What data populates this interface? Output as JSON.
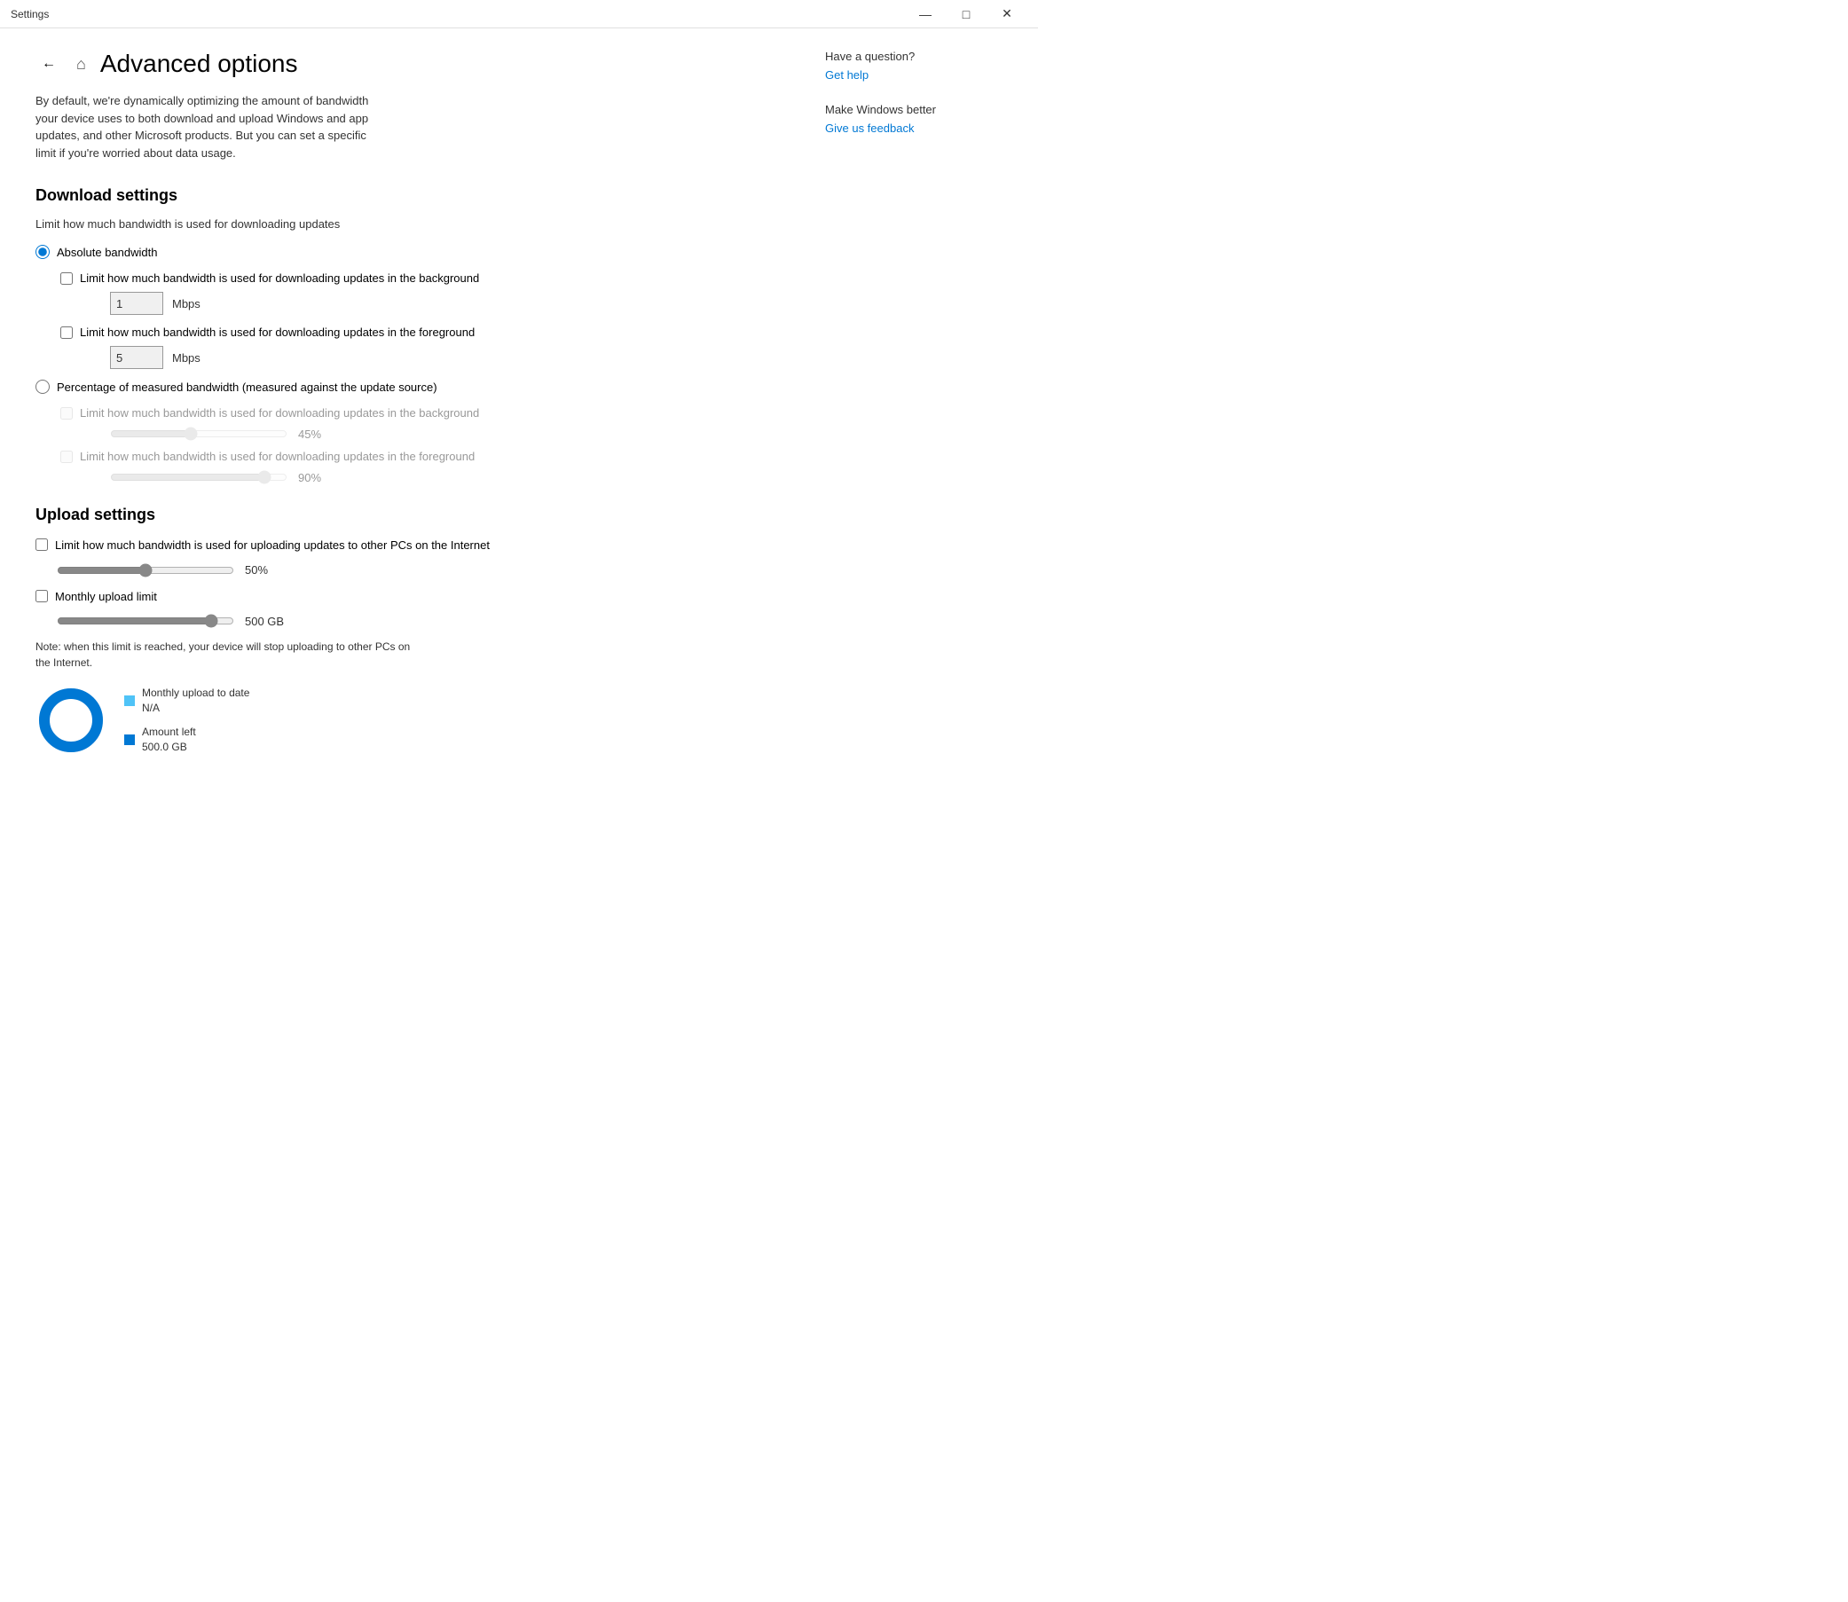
{
  "titlebar": {
    "title": "Settings",
    "minimize": "—",
    "maximize": "□",
    "close": "✕"
  },
  "header": {
    "back_icon": "←",
    "home_icon": "⌂",
    "page_title": "Advanced options"
  },
  "description": "By default, we're dynamically optimizing the amount of bandwidth your device uses to both download and upload Windows and app updates, and other Microsoft products. But you can set a specific limit if you're worried about data usage.",
  "download_settings": {
    "section_title": "Download settings",
    "section_desc": "Limit how much bandwidth is used for downloading updates",
    "radio_absolute": "Absolute bandwidth",
    "radio_absolute_checked": true,
    "radio_percentage": "Percentage of measured bandwidth (measured against the update source)",
    "radio_percentage_checked": false,
    "bg_checkbox_label": "Limit how much bandwidth is used for downloading updates in the background",
    "bg_checkbox_checked": false,
    "bg_input_value": "1",
    "bg_mbps": "Mbps",
    "fg_checkbox_label": "Limit how much bandwidth is used for downloading updates in the foreground",
    "fg_checkbox_checked": false,
    "fg_input_value": "5",
    "fg_mbps": "Mbps",
    "pct_bg_checkbox_label": "Limit how much bandwidth is used for downloading updates in the background",
    "pct_bg_slider_value": "45%",
    "pct_bg_slider": 45,
    "pct_fg_checkbox_label": "Limit how much bandwidth is used for downloading updates in the foreground",
    "pct_fg_slider_value": "90%",
    "pct_fg_slider": 90
  },
  "upload_settings": {
    "section_title": "Upload settings",
    "upload_checkbox_label": "Limit how much bandwidth is used for uploading updates to other PCs on the Internet",
    "upload_checkbox_checked": false,
    "upload_slider_value": "50%",
    "upload_slider": 50,
    "monthly_limit_label": "Monthly upload limit",
    "monthly_limit_checked": false,
    "monthly_slider_value": "500 GB",
    "monthly_slider": 90,
    "note": "Note: when this limit is reached, your device will stop uploading to other PCs on the Internet.",
    "monthly_upload_label": "Monthly upload to date",
    "monthly_upload_value": "N/A",
    "amount_left_label": "Amount left",
    "amount_left_value": "500.0 GB"
  },
  "sidebar": {
    "question_title": "Have a question?",
    "get_help_link": "Get help",
    "make_better_title": "Make Windows better",
    "feedback_link": "Give us feedback"
  },
  "colors": {
    "accent": "#0078d4",
    "donut_blue": "#0078d4",
    "donut_light": "#e8e8e8"
  }
}
